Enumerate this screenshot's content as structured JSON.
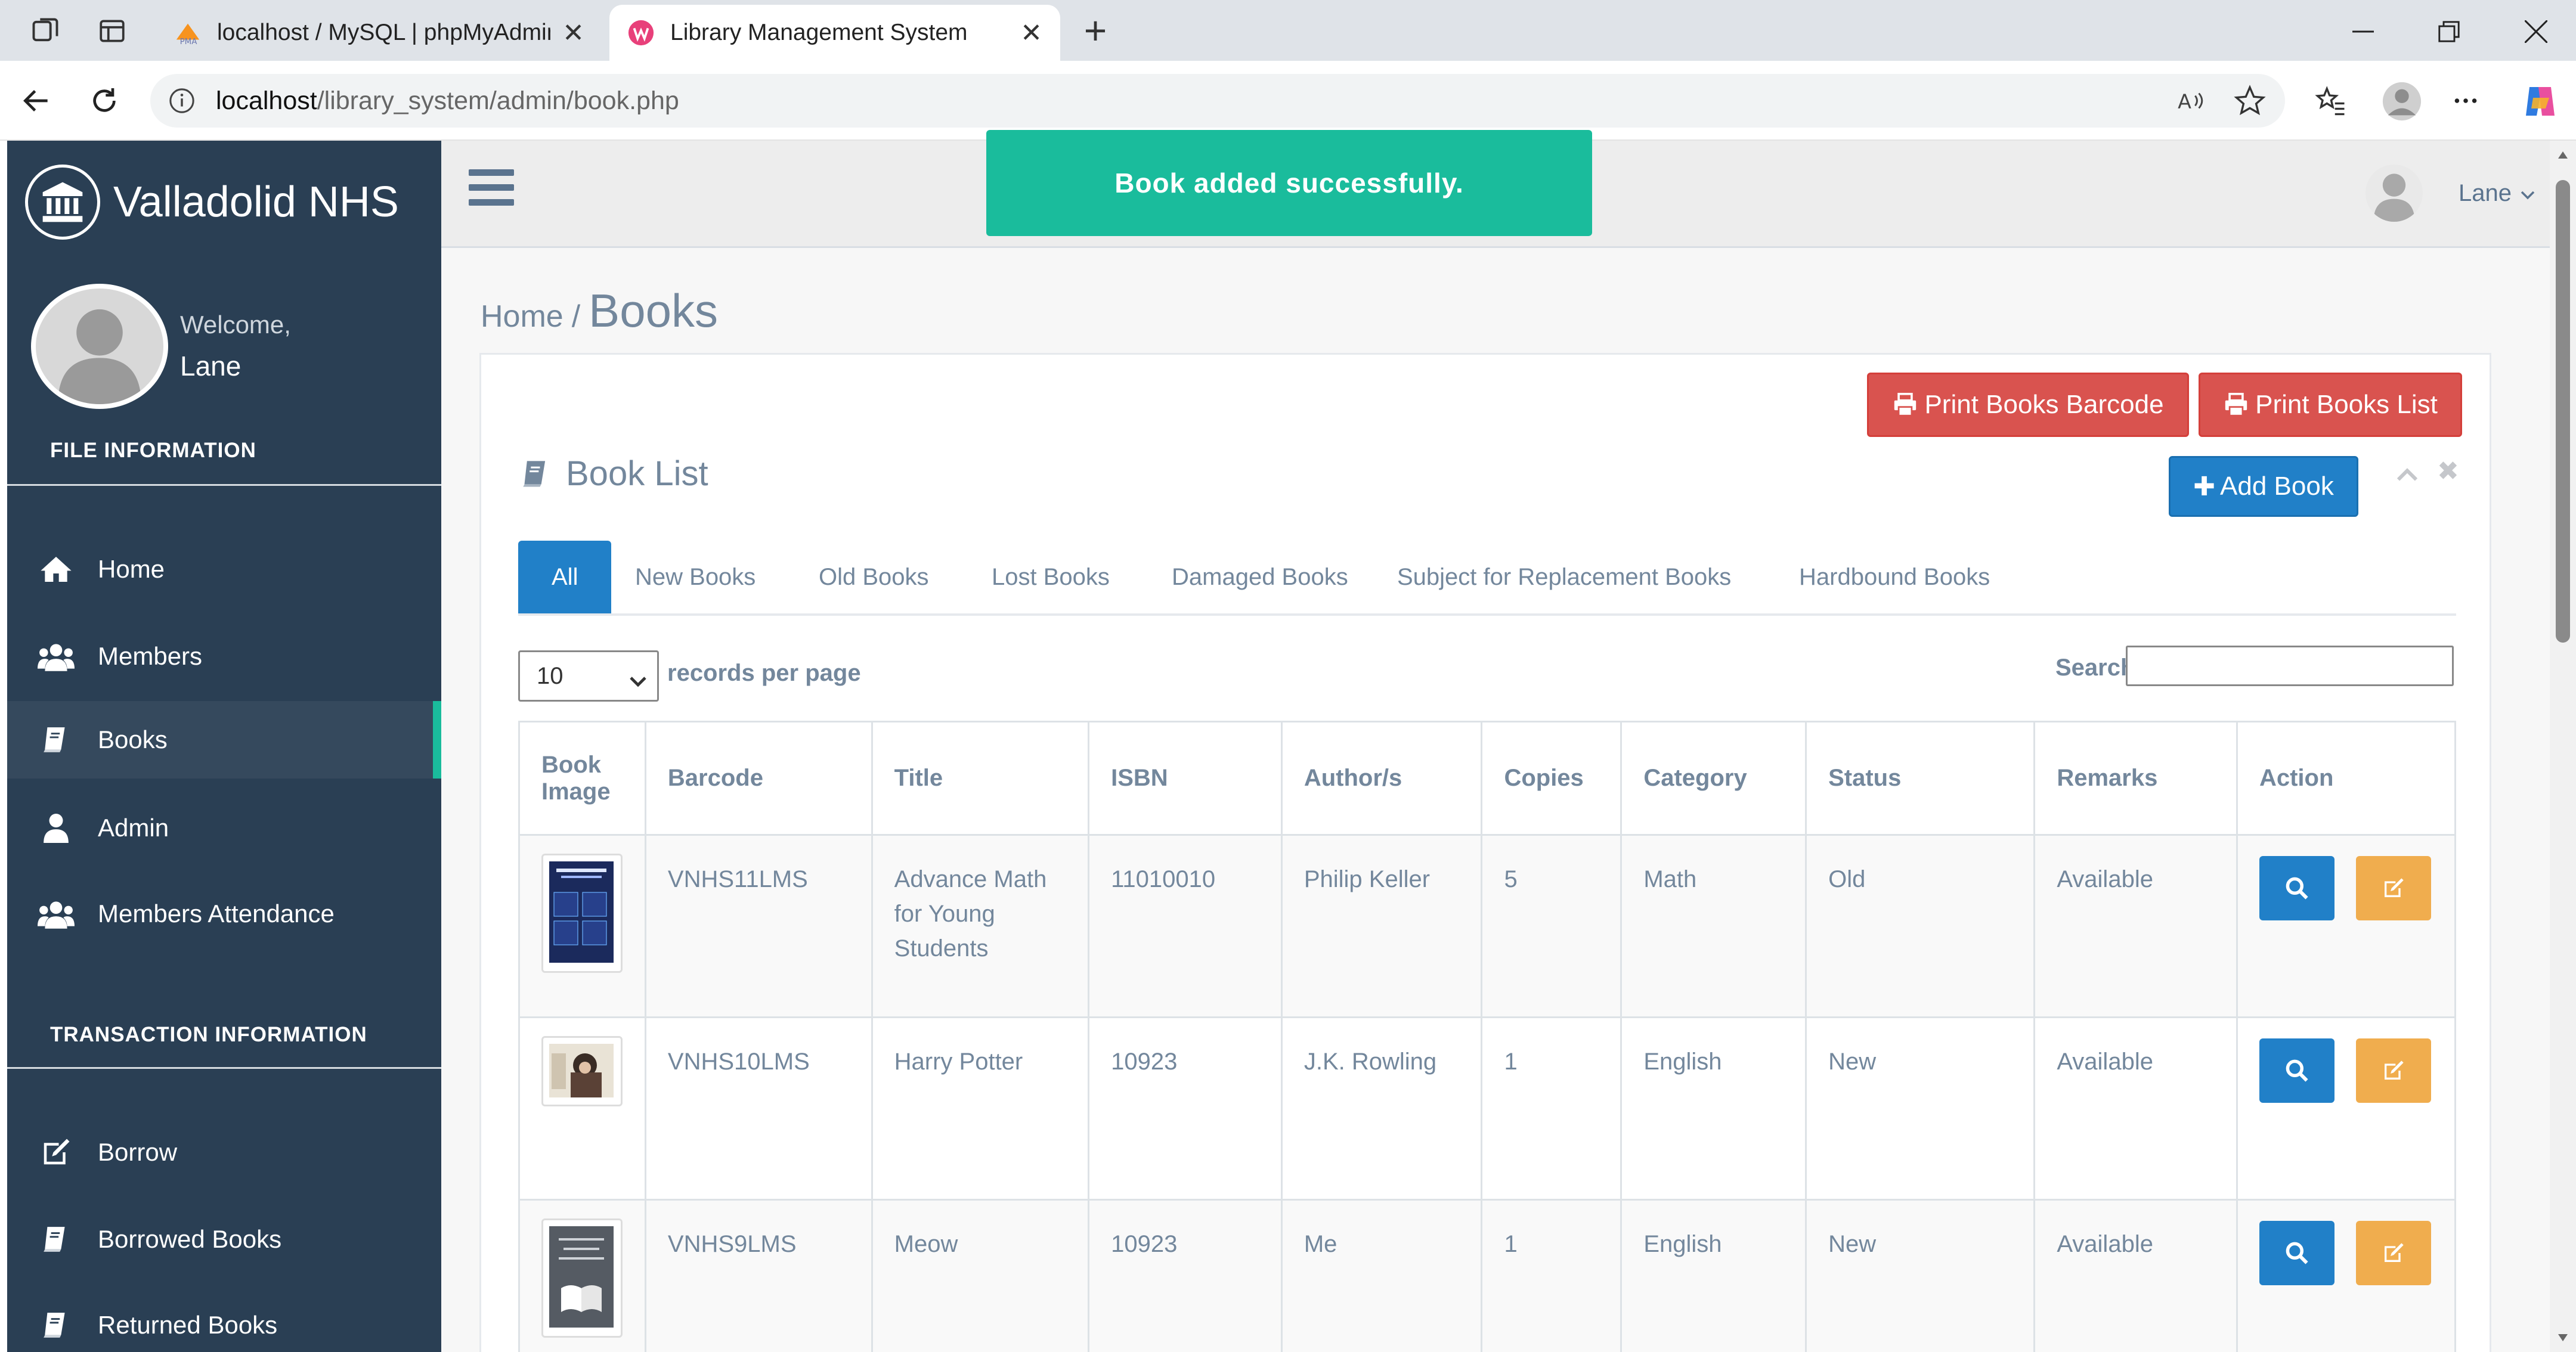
{
  "browser": {
    "tabs": [
      {
        "title": "localhost / MySQL | phpMyAdmin",
        "active": false
      },
      {
        "title": "Library Management System",
        "active": true
      }
    ],
    "url_host": "localhost",
    "url_path": "/library_system/admin/book.php"
  },
  "sidebar": {
    "brand": "Valladolid NHS",
    "welcome": "Welcome,",
    "user": "Lane",
    "section_file": "FILE INFORMATION",
    "section_transaction": "TRANSACTION INFORMATION",
    "file_items": [
      {
        "label": "Home",
        "icon": "home-icon"
      },
      {
        "label": "Members",
        "icon": "users-icon"
      },
      {
        "label": "Books",
        "icon": "book-icon",
        "active": true
      },
      {
        "label": "Admin",
        "icon": "user-icon"
      },
      {
        "label": "Members Attendance",
        "icon": "users-icon"
      }
    ],
    "transaction_items": [
      {
        "label": "Borrow",
        "icon": "edit-icon"
      },
      {
        "label": "Borrowed Books",
        "icon": "book-icon"
      },
      {
        "label": "Returned Books",
        "icon": "book-icon"
      }
    ]
  },
  "topnav": {
    "user": "Lane"
  },
  "toast": "Book added successfully.",
  "breadcrumb": {
    "home": "Home",
    "sep": "/",
    "current": "Books"
  },
  "panel": {
    "print_barcode": "Print Books Barcode",
    "print_list": "Print Books List",
    "title": "Book List",
    "add_book": "Add Book",
    "tabs": [
      "All",
      "New Books",
      "Old Books",
      "Lost Books",
      "Damaged Books",
      "Subject for Replacement Books",
      "Hardbound Books"
    ],
    "length_value": "10",
    "length_label": "records per page",
    "search_label": "Search:"
  },
  "table": {
    "headers": [
      "Book Image",
      "Barcode",
      "Title",
      "ISBN",
      "Author/s",
      "Copies",
      "Category",
      "Status",
      "Remarks",
      "Action"
    ],
    "rows": [
      {
        "barcode": "VNHS11LMS",
        "title": "Advance Math for Young Students",
        "isbn": "11010010",
        "author": "Philip Keller",
        "copies": "5",
        "category": "Math",
        "status": "Old",
        "remarks": "Available"
      },
      {
        "barcode": "VNHS10LMS",
        "title": "Harry Potter",
        "isbn": "10923",
        "author": "J.K. Rowling",
        "copies": "1",
        "category": "English",
        "status": "New",
        "remarks": "Available"
      },
      {
        "barcode": "VNHS9LMS",
        "title": "Meow",
        "isbn": "10923",
        "author": "Me",
        "copies": "1",
        "category": "English",
        "status": "New",
        "remarks": "Available"
      }
    ]
  },
  "colors": {
    "sidebar": "#2a3f54",
    "accent": "#1abb9c",
    "primary": "#2180c8",
    "danger": "#d9534f",
    "warning": "#f0ad4e"
  }
}
